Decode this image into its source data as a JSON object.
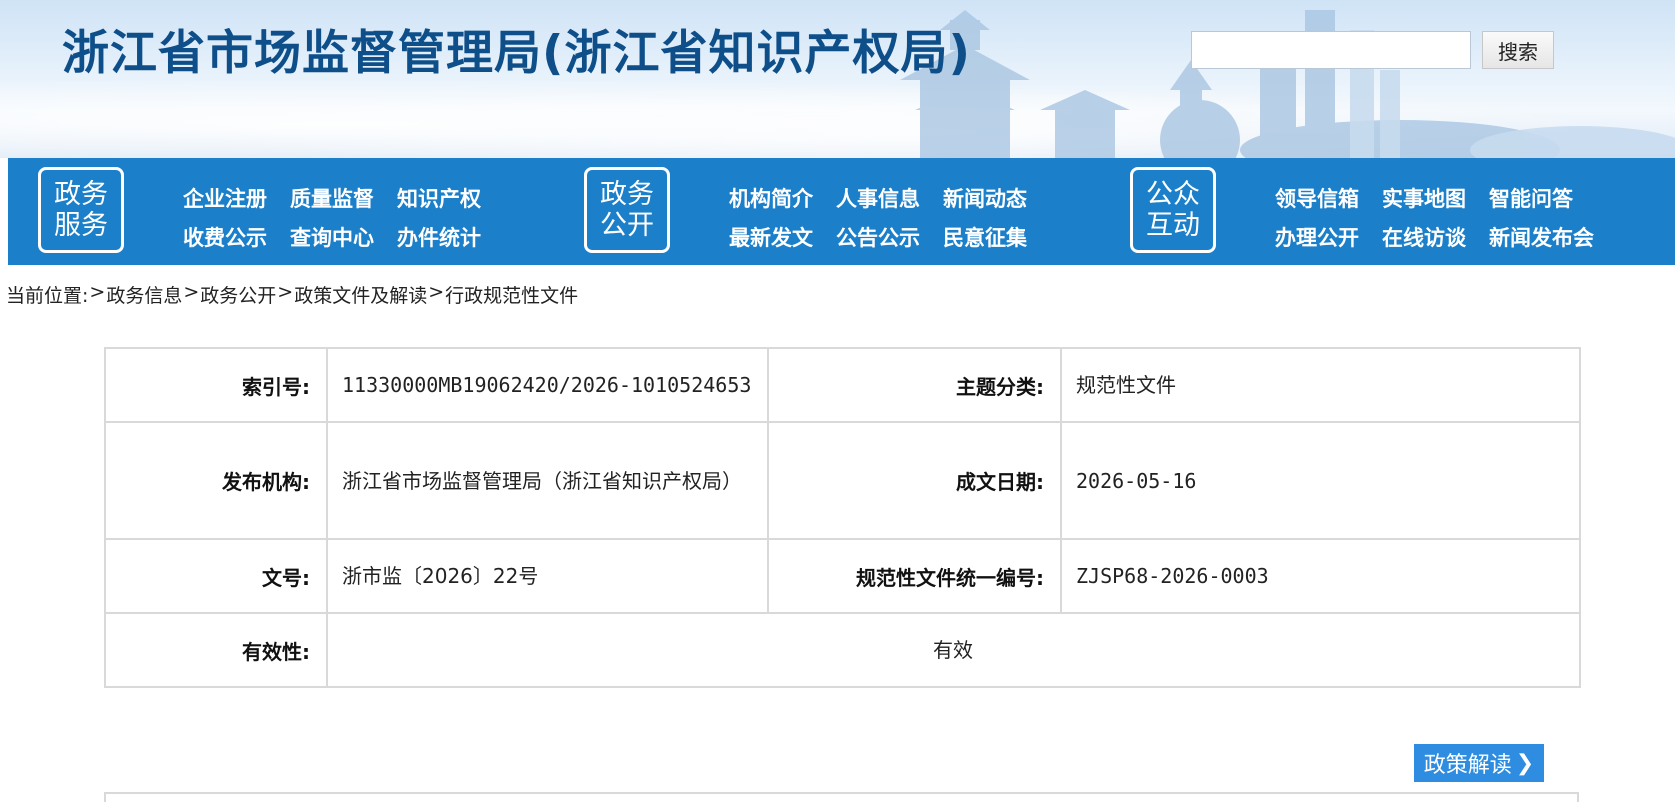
{
  "header": {
    "title": "浙江省市场监督管理局(浙江省知识产权局)",
    "search": {
      "value": "",
      "placeholder": "",
      "button_label": "搜索"
    }
  },
  "nav": {
    "groups": [
      {
        "box_lines": [
          "政务",
          "服务"
        ],
        "rows": [
          [
            "企业注册",
            "质量监督",
            "知识产权"
          ],
          [
            "收费公示",
            "查询中心",
            "办件统计"
          ]
        ]
      },
      {
        "box_lines": [
          "政务",
          "公开"
        ],
        "rows": [
          [
            "机构简介",
            "人事信息",
            "新闻动态"
          ],
          [
            "最新发文",
            "公告公示",
            "民意征集"
          ]
        ]
      },
      {
        "box_lines": [
          "公众",
          "互动"
        ],
        "rows": [
          [
            "领导信箱",
            "实事地图",
            "智能问答"
          ],
          [
            "办理公开",
            "在线访谈",
            "新闻发布会"
          ]
        ]
      }
    ]
  },
  "breadcrumb": {
    "prefix": "当前位置:",
    "separator": ">",
    "items": [
      "政务信息",
      "政务公开",
      "政策文件及解读",
      "行政规范性文件"
    ]
  },
  "info": {
    "index_no_label": "索引号:",
    "index_no": "11330000MB19062420/2026-1010524653",
    "topic_label": "主题分类:",
    "topic": "规范性文件",
    "publisher_label": "发布机构:",
    "publisher": "浙江省市场监督管理局（浙江省知识产权局）",
    "date_label": "成文日期:",
    "date": "2026-05-16",
    "doc_no_label": "文号:",
    "doc_no": "浙市监〔2026〕22号",
    "unified_no_label": "规范性文件统一编号:",
    "unified_no": "ZJSP68-2026-0003",
    "validity_label": "有效性:",
    "validity": "有效"
  },
  "policy_button": {
    "label": "政策解读",
    "chevron": "❯"
  },
  "colors": {
    "nav_blue": "#1c7fc9",
    "title_blue": "#0e4f8a",
    "button_blue": "#2e8de0"
  }
}
